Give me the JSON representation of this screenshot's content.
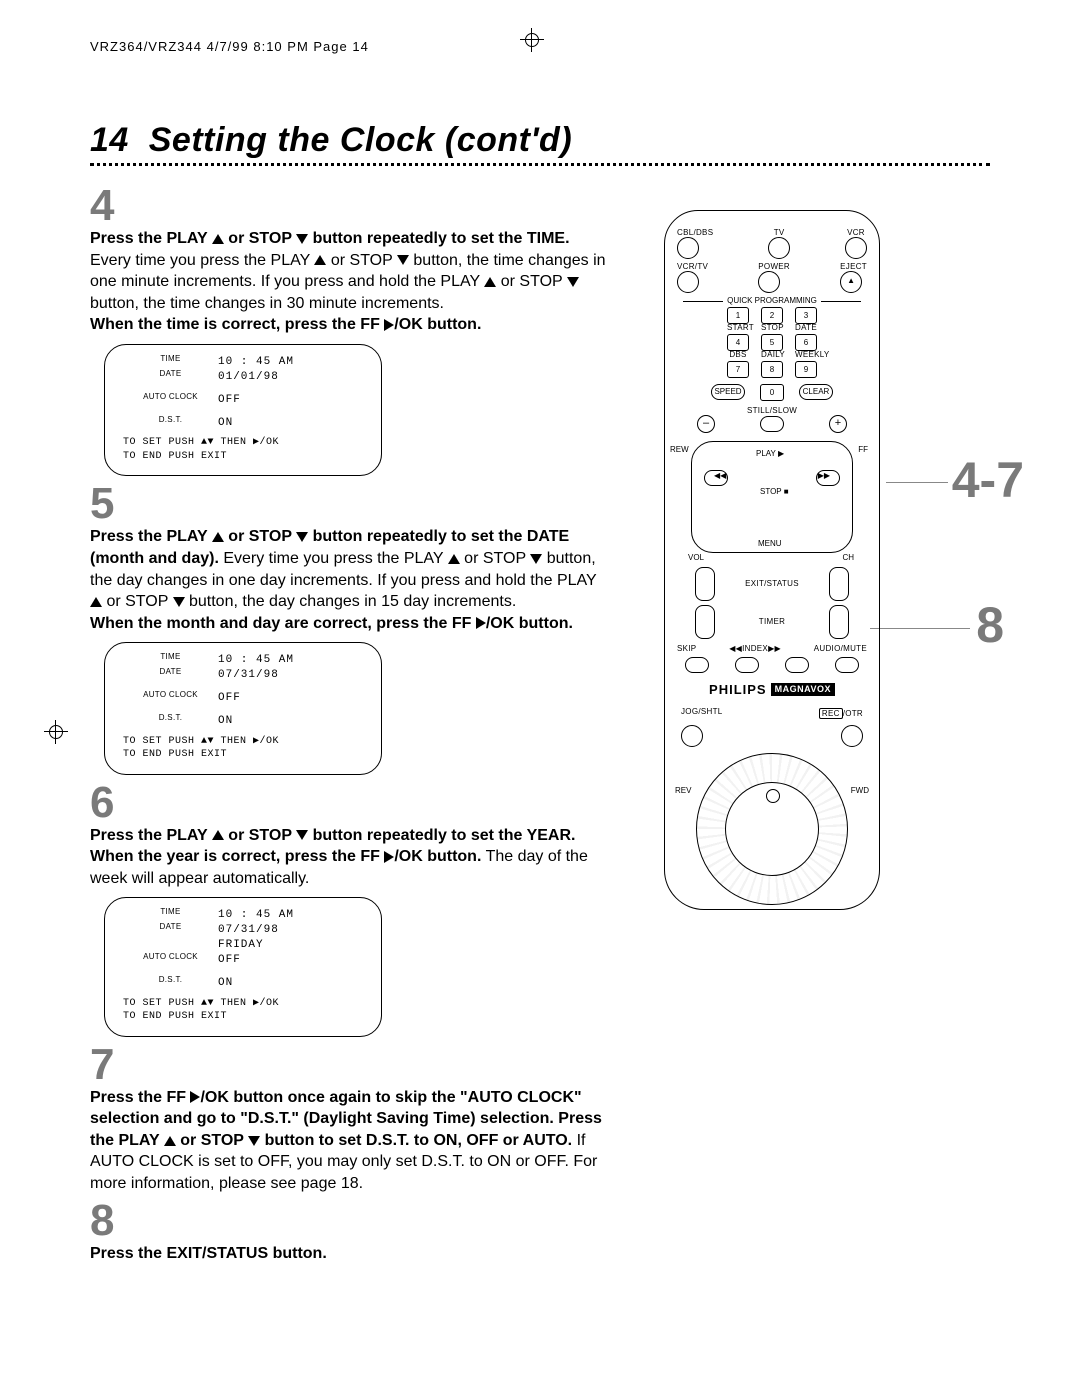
{
  "header": {
    "slug": "VRZ364/VRZ344  4/7/99 8:10 PM  Page 14"
  },
  "title": {
    "page_number": "14",
    "text": "Setting the Clock (cont'd)"
  },
  "steps": {
    "s4": {
      "num": "4",
      "bold1": "Press the PLAY ",
      "bold2": " or STOP ",
      "bold3": " button repeatedly to set the TIME.",
      "body1": " Every time you press the PLAY ",
      "body2": " or STOP ",
      "body3": " button, the time changes in one minute increments. If you press and hold the PLAY ",
      "body4": " or STOP ",
      "body5": " button, the time changes in 30 minute increments.",
      "bold_end": "When the time is correct, press the FF ",
      "bold_end2": "/OK button."
    },
    "s5": {
      "num": "5",
      "bold1": "Press the PLAY ",
      "bold2": " or STOP ",
      "bold3": " button repeatedly to set the DATE (month and day).",
      "body1": " Every time you press the PLAY ",
      "body2": " or STOP ",
      "body3": " button, the day changes in one day increments. If you press and hold the PLAY ",
      "body4": " or STOP ",
      "body5": " button, the day changes in 15 day increments.",
      "bold_end": "When the month and day are correct, press the FF ",
      "bold_end2": "/OK button."
    },
    "s6": {
      "num": "6",
      "bold1": "Press the PLAY ",
      "bold2": " or STOP ",
      "bold3": " button repeatedly to set the YEAR. When the year is correct, press the FF ",
      "bold4": "/OK button.",
      "body": " The day of the week will appear automatically."
    },
    "s7": {
      "num": "7",
      "bold": "Press the FF ",
      "bold2": "/OK button once again to skip the \"AUTO CLOCK\" selection and go to \"D.S.T.\" (Daylight Saving Time) selection. Press the PLAY ",
      "bold3": " or STOP ",
      "bold4": " button to set D.S.T. to ON, OFF or AUTO.",
      "body": " If AUTO CLOCK is set to OFF, you may only set D.S.T. to ON or OFF. For more information, please see page 18."
    },
    "s8": {
      "num": "8",
      "bold": "Press the EXIT/STATUS button."
    }
  },
  "osd": {
    "labels": {
      "time": "TIME",
      "date": "DATE",
      "auto": "AUTO CLOCK",
      "dst": "D.S.T."
    },
    "values": {
      "auto_off": "OFF",
      "dst_on": "ON",
      "s4_time": "10 : 45 AM",
      "s4_date": "01/01/98",
      "s5_time": "10 : 45 AM",
      "s5_date": "07/31/98",
      "s6_time": "10 : 45 AM",
      "s6_date": "07/31/98",
      "s6_day": "FRIDAY"
    },
    "footer1": "TO SET PUSH ▲▼ THEN ▶/OK",
    "footer2": "TO END PUSH EXIT"
  },
  "remote": {
    "row1": [
      "CBL/DBS",
      "TV",
      "VCR"
    ],
    "row2": [
      "VCR/TV",
      "POWER",
      "EJECT"
    ],
    "qp": "QUICK PROGRAMMING",
    "numlabels": [
      [
        "START",
        "STOP",
        "DATE"
      ],
      [
        "DBS",
        "DAILY",
        "WEEKLY"
      ],
      [
        "",
        "",
        ""
      ]
    ],
    "nums": [
      "1",
      "2",
      "3",
      "4",
      "5",
      "6",
      "7",
      "8",
      "9"
    ],
    "row_bottom": [
      "SPEED",
      "0",
      "CLEAR"
    ],
    "stillslow": "STILL/SLOW",
    "minus": "–",
    "plus": "+",
    "rew": "REW",
    "ff": "FF",
    "play": "PLAY ▶",
    "stop": "STOP ■",
    "vol": "VOL",
    "ch": "CH",
    "menu": "MENU",
    "exit": "EXIT/STATUS",
    "timer": "TIMER",
    "skip": "SKIP",
    "index": "◀◀INDEX▶▶",
    "audio": "AUDIO/MUTE",
    "brand_p": "PHILIPS",
    "brand_m": "MAGNAVOX",
    "jog": "JOG/SHTL",
    "rec": "REC",
    "otr": "/OTR",
    "rev": "REV",
    "fwd": "FWD"
  },
  "callout": {
    "a": "4-7",
    "b": "8"
  }
}
